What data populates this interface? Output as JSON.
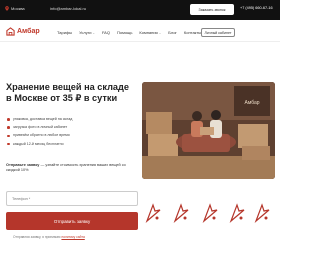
{
  "topbar": {
    "city": "Москва",
    "email": "info@ambar-lokal.ru",
    "callback_label": "Заказать звонок",
    "phone": "+7 (495) 660-67-16"
  },
  "brand": {
    "name": "Амбар"
  },
  "nav": {
    "items": [
      {
        "label": "Тарифы",
        "has_dropdown": false
      },
      {
        "label": "Услуги",
        "has_dropdown": true
      },
      {
        "label": "FAQ",
        "has_dropdown": false
      },
      {
        "label": "Помощь",
        "has_dropdown": false
      },
      {
        "label": "Компания",
        "has_dropdown": true
      },
      {
        "label": "Блог",
        "has_dropdown": false
      },
      {
        "label": "Контакты",
        "has_dropdown": false
      }
    ],
    "cabinet_label": "Личный кабинет"
  },
  "hero": {
    "title": "Хранение вещей на складе в Москве от 35 ₽ в сутки",
    "bullets": [
      "упаковка, доставка вещей на склад",
      "загрузка фото в личный кабинет",
      "привезём обратно в любое время",
      "каждый 12-й месяц бесплатно"
    ],
    "photo_sign": "Амбар"
  },
  "form": {
    "offer_lead": "Отправьте заявку",
    "offer_rest": " — узнайте стоимость хранения ваших вещей со скидкой 10%",
    "phone_placeholder": "Телефон *",
    "submit_label": "Отправить заявку",
    "consent_text": "Отправляя заявку, я принимаю ",
    "consent_link": "политику сайта"
  },
  "colors": {
    "accent": "#b5362b",
    "topbar": "#111111"
  },
  "features": {
    "icons": [
      "feature-icon-1",
      "feature-icon-2",
      "feature-icon-3",
      "feature-icon-4",
      "feature-icon-5"
    ]
  }
}
